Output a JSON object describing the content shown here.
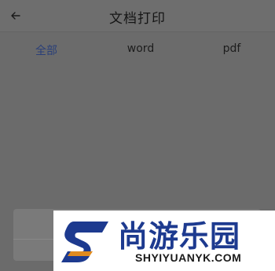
{
  "header": {
    "back_icon": "arrow-left-icon",
    "title": "文档打印"
  },
  "tabs": [
    {
      "label": "全部",
      "active": true
    },
    {
      "label": "word",
      "active": false
    },
    {
      "label": "pdf",
      "active": false
    }
  ],
  "watermark": {
    "brand": "尚游乐园",
    "site": "SHYIYUANYK.COM"
  },
  "colors": {
    "active_tab": "#2a3f78",
    "overlay": "#6b6b6b",
    "brand": "#1d3a8f"
  }
}
